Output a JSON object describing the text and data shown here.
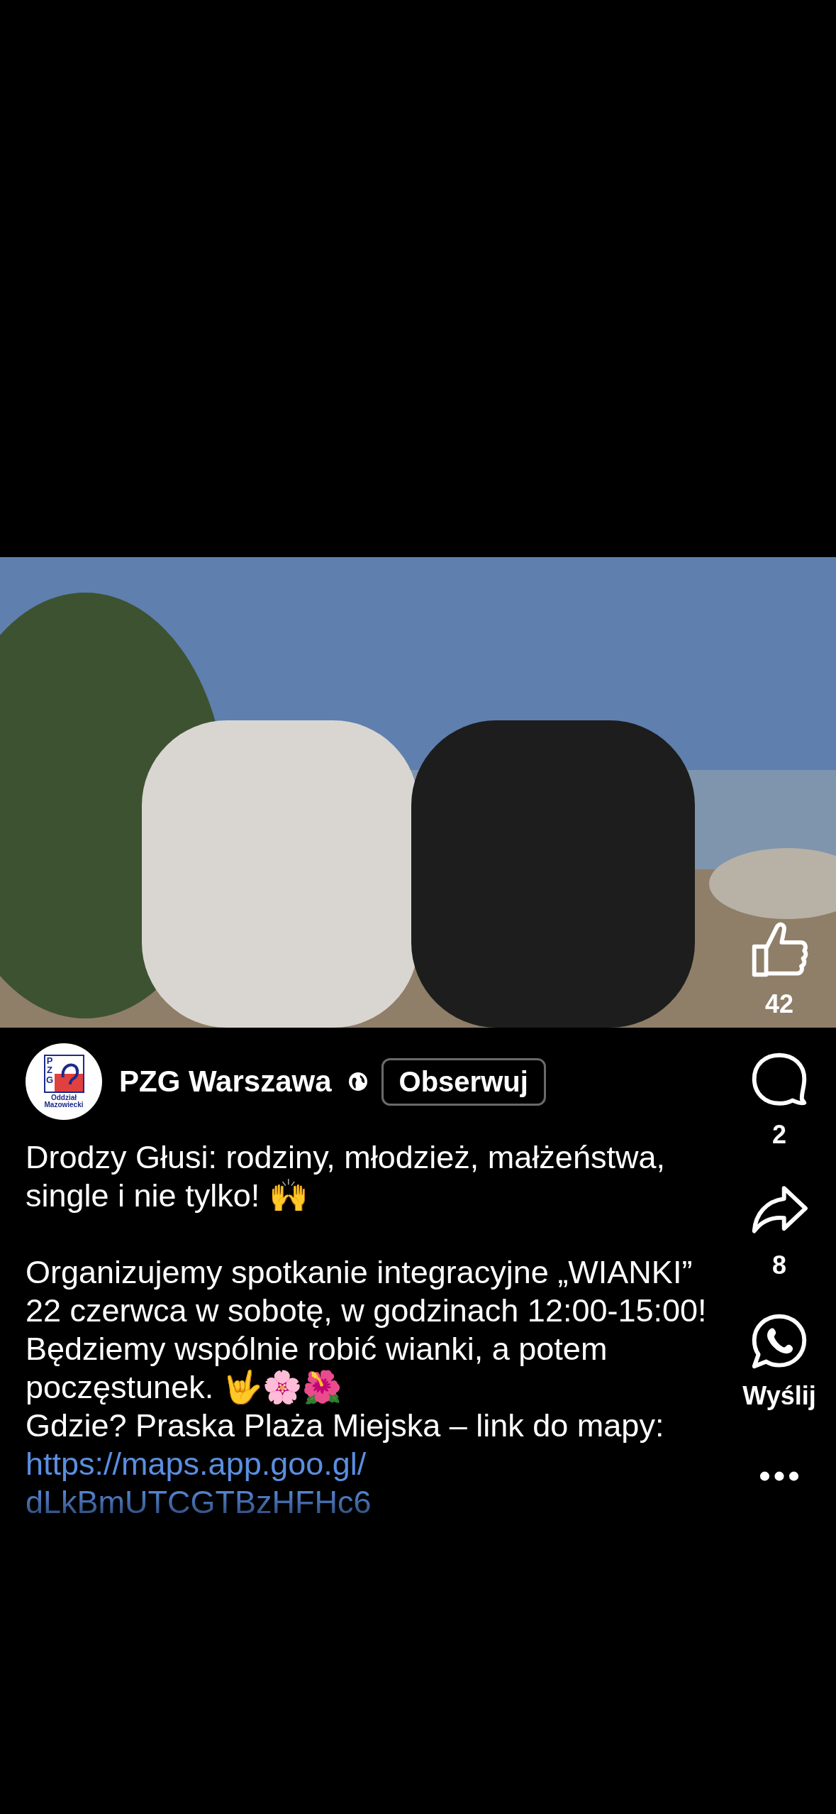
{
  "author": {
    "name": "PZG Warszawa",
    "logo_letters": "PZG",
    "logo_caption": [
      "Oddział",
      "Mazowiecki"
    ],
    "follow_button": "Obserwuj"
  },
  "caption": [
    {
      "kind": "text",
      "text": "Drodzy Głusi: rodziny, młodzież, małżeństwa, single i nie tylko! 🙌"
    },
    {
      "kind": "gap"
    },
    {
      "kind": "text",
      "text": "Organizujemy spotkanie integracyjne „WIANKI” 22 czerwca w sobotę, w godzinach 12:00-15:00!"
    },
    {
      "kind": "text",
      "text": "Będziemy wspólnie robić wianki, a potem poczęstunek. 🤟🌸🌺"
    },
    {
      "kind": "text",
      "text": "Gdzie? Praska Plaża Miejska – link do mapy:"
    },
    {
      "kind": "link",
      "text": "https://maps.app.goo.gl/ dLkBmUTCGTBzHFHc6"
    }
  ],
  "actions": [
    {
      "kind": "like",
      "label": "42"
    },
    {
      "kind": "comment",
      "label": "2"
    },
    {
      "kind": "share",
      "label": "8"
    },
    {
      "kind": "whatsapp",
      "label": "Wyślij"
    },
    {
      "kind": "more"
    }
  ]
}
